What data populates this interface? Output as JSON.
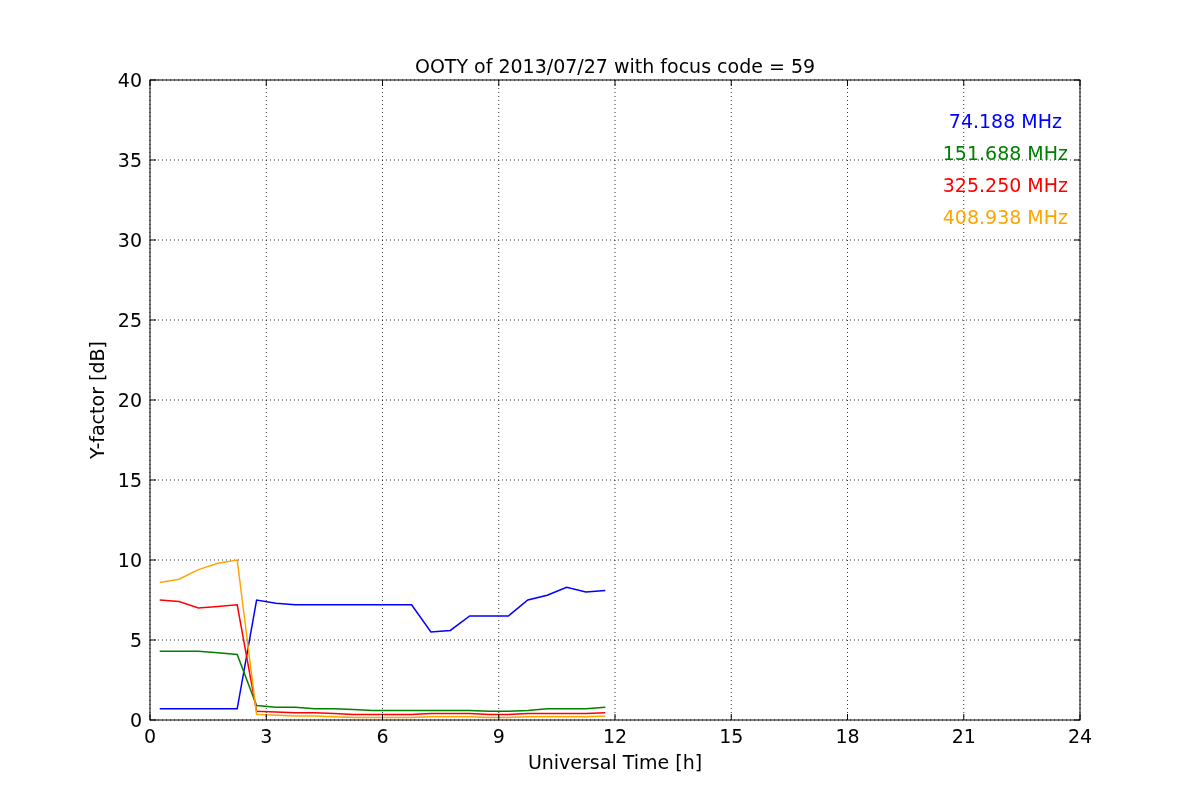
{
  "figure": {
    "chart_data": {
      "type": "line",
      "title": "OOTY of 2013/07/27 with focus code = 59",
      "xlabel": "Universal Time [h]",
      "ylabel": "Y-factor [dB]",
      "x": [
        0.25,
        0.75,
        1.25,
        1.75,
        2.25,
        2.75,
        3.25,
        3.75,
        4.25,
        4.75,
        5.25,
        5.75,
        6.25,
        6.75,
        7.25,
        7.75,
        8.25,
        8.75,
        9.25,
        9.75,
        10.25,
        10.75,
        11.25,
        11.75
      ],
      "series": [
        {
          "name": "74.188 MHz",
          "color": "#0000ff",
          "values": [
            0.7,
            0.7,
            0.7,
            0.7,
            0.7,
            7.5,
            7.3,
            7.2,
            7.2,
            7.2,
            7.2,
            7.2,
            7.2,
            7.2,
            5.5,
            5.6,
            6.5,
            6.5,
            6.5,
            7.5,
            7.8,
            8.3,
            8.0,
            8.1
          ]
        },
        {
          "name": "151.688 MHz",
          "color": "#008000",
          "values": [
            4.3,
            4.3,
            4.3,
            4.2,
            4.1,
            0.9,
            0.8,
            0.8,
            0.7,
            0.7,
            0.65,
            0.6,
            0.6,
            0.6,
            0.6,
            0.6,
            0.6,
            0.55,
            0.55,
            0.6,
            0.7,
            0.7,
            0.7,
            0.8
          ]
        },
        {
          "name": "325.250 MHz",
          "color": "#ff0000",
          "values": [
            7.5,
            7.4,
            7.0,
            7.1,
            7.2,
            0.55,
            0.5,
            0.45,
            0.45,
            0.4,
            0.35,
            0.35,
            0.35,
            0.35,
            0.4,
            0.4,
            0.4,
            0.35,
            0.35,
            0.4,
            0.4,
            0.4,
            0.4,
            0.45
          ]
        },
        {
          "name": "408.938 MHz",
          "color": "#ffa500",
          "values": [
            8.6,
            8.8,
            9.4,
            9.8,
            10.0,
            0.35,
            0.3,
            0.25,
            0.25,
            0.2,
            0.15,
            0.15,
            0.15,
            0.15,
            0.2,
            0.2,
            0.2,
            0.15,
            0.15,
            0.2,
            0.2,
            0.2,
            0.2,
            0.25
          ]
        }
      ],
      "xlim": [
        0,
        24
      ],
      "ylim": [
        0,
        40
      ],
      "grid": true,
      "xticks": [
        0,
        3,
        6,
        9,
        12,
        15,
        18,
        21,
        24
      ],
      "yticks": [
        0,
        5,
        10,
        15,
        20,
        25,
        30,
        35,
        40
      ]
    }
  }
}
